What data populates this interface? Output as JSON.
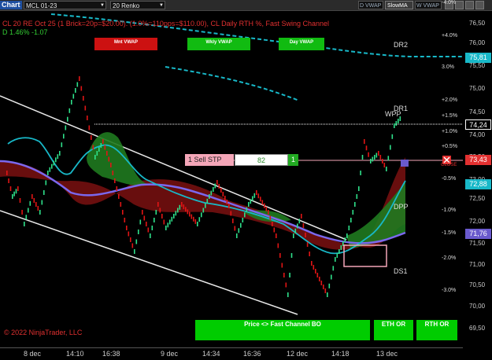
{
  "toolbar": {
    "chart_label": "Chart",
    "instrument": "MCL 01-23",
    "bar_type": "20 Renko",
    "dvwap_label": "D VWAP",
    "slowma_label": "SlowMA",
    "wvwap_label": "W VWAP"
  },
  "header": {
    "line1": "CL 20 RE Oct 25 (1 Brick=20p=$20.00). (1.0%=110pps=$110.00), CL Daily RTH %, Fast Swing Channel",
    "line2": "D 1.46% -1.07"
  },
  "vwap_buttons": {
    "mnt": "Mnt VWAP",
    "wkly": "Wkly VWAP",
    "day": "Day VWAP"
  },
  "order": {
    "label": "1  Sell STP",
    "quantity": "82",
    "button": "1",
    "close_label": "CLOSE"
  },
  "levels": {
    "dr2": "DR2",
    "dr1": "DR1",
    "wpp": "WPP",
    "dpp": "DPP",
    "ds1": "DS1"
  },
  "price_axis": [
    "76,50",
    "76,00",
    "75,50",
    "75,00",
    "74,50",
    "74,00",
    "73,50",
    "73,00",
    "72,50",
    "72,00",
    "71,50",
    "71,00",
    "70,50",
    "70,00",
    "69,50"
  ],
  "pct_axis": [
    "+4.0%",
    "3.0%",
    "+2.0%",
    "+1.5%",
    "+1.0%",
    "+0.5%",
    "-0.5%",
    "-1.0%",
    "-1.5%",
    "-2.0%",
    "-3.0%",
    "-4.0%"
  ],
  "price_tags": [
    {
      "value": "75,81",
      "color": "#18b8c8"
    },
    {
      "value": "74,24",
      "color": "#000000"
    },
    {
      "value": "73,43",
      "color": "#e23030"
    },
    {
      "value": "72,88",
      "color": "#18b8c8"
    },
    {
      "value": "71,76",
      "color": "#6a5acd"
    }
  ],
  "x_axis": [
    "8 dec",
    "14:10",
    "16:38",
    "9 dec",
    "14:34",
    "16:36",
    "12 dec",
    "14:18",
    "13 dec"
  ],
  "copyright": "© 2022 NinjaTrader, LLC",
  "bottom_buttons": {
    "channel": "Price <> Fast Channel BO",
    "eth": "ETH OR",
    "rth": "RTH OR"
  },
  "colors": {
    "up_brick": "#2ee08a",
    "down_brick": "#e01515",
    "vwap_day": "#7b68ee",
    "cyan_ma": "#18b8c8",
    "green_cloud": "#1f7a1f",
    "red_cloud": "#7a1010"
  }
}
